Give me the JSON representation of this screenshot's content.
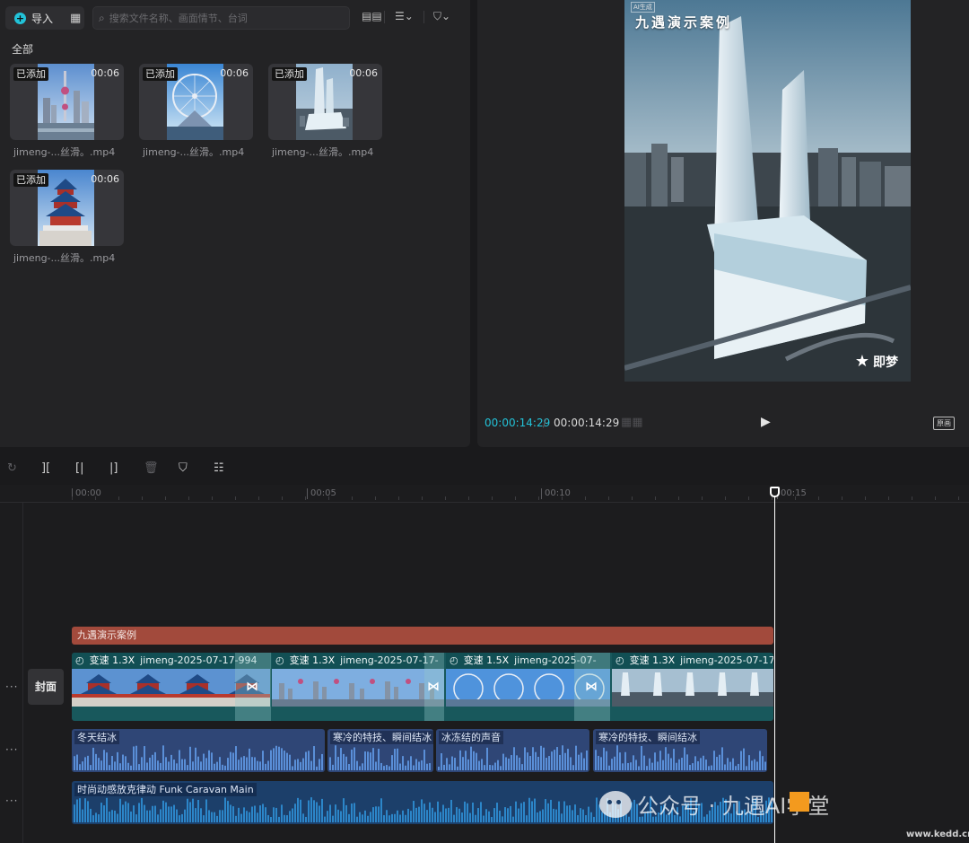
{
  "media": {
    "import_label": "导入",
    "search_placeholder": "搜索文件名称、画面情节、台词",
    "section_title": "全部",
    "items": [
      {
        "badge": "已添加",
        "duration": "00:06",
        "name": "jimeng-...丝滑。.mp4"
      },
      {
        "badge": "已添加",
        "duration": "00:06",
        "name": "jimeng-...丝滑。.mp4"
      },
      {
        "badge": "已添加",
        "duration": "00:06",
        "name": "jimeng-...丝滑。.mp4"
      },
      {
        "badge": "已添加",
        "duration": "00:06",
        "name": "jimeng-...丝滑。.mp4"
      }
    ]
  },
  "preview": {
    "video_title": "九遇演示案例",
    "ai_tag": "AI生成",
    "logo_text": "即梦",
    "current_time": "00:00:14:29",
    "separator": "/",
    "total_time": "00:00:14:29",
    "original_label": "原画"
  },
  "icons": {
    "import": "plus-circle-icon",
    "grid": "grid-icon",
    "search": "search-icon",
    "layout": "layout-icon",
    "sort": "sort-icon",
    "filter": "filter-icon",
    "play": "play-icon",
    "redo": "redo-icon",
    "split": "split-icon",
    "trim_left": "trim-left-icon",
    "trim_right": "trim-right-icon",
    "delete": "trash-icon",
    "mark": "shield-icon",
    "edit": "edit-list-icon"
  },
  "timeline": {
    "ruler": [
      "00:00",
      "00:05",
      "00:10",
      "00:15"
    ],
    "cover_label": "封面",
    "text_clip": "九遇演示案例",
    "video_clips": [
      {
        "speed": "变速 1.3X",
        "name": "jimeng-2025-07-17-994"
      },
      {
        "speed": "变速 1.3X",
        "name": "jimeng-2025-07-17-"
      },
      {
        "speed": "变速 1.5X",
        "name": "jimeng-2025-07-"
      },
      {
        "speed": "变速 1.3X",
        "name": "jimeng-2025-07-17-"
      }
    ],
    "audio_clips": [
      "冬天结冰",
      "寒冷的特技、瞬间结冰",
      "冰冻结的声音",
      "寒冷的特技、瞬间结冰"
    ],
    "music_clip": "时尚动感放克律动  Funk Caravan Main"
  },
  "watermark": {
    "text": "公众号 · 九遇AI学堂",
    "url": "www.kedd.cn"
  },
  "colors": {
    "accent": "#23c2d8",
    "text_clip": "#a24a3c",
    "video_track": "#18585c",
    "audio_clip": "#2f4676",
    "music_clip": "#1c3f6a"
  }
}
